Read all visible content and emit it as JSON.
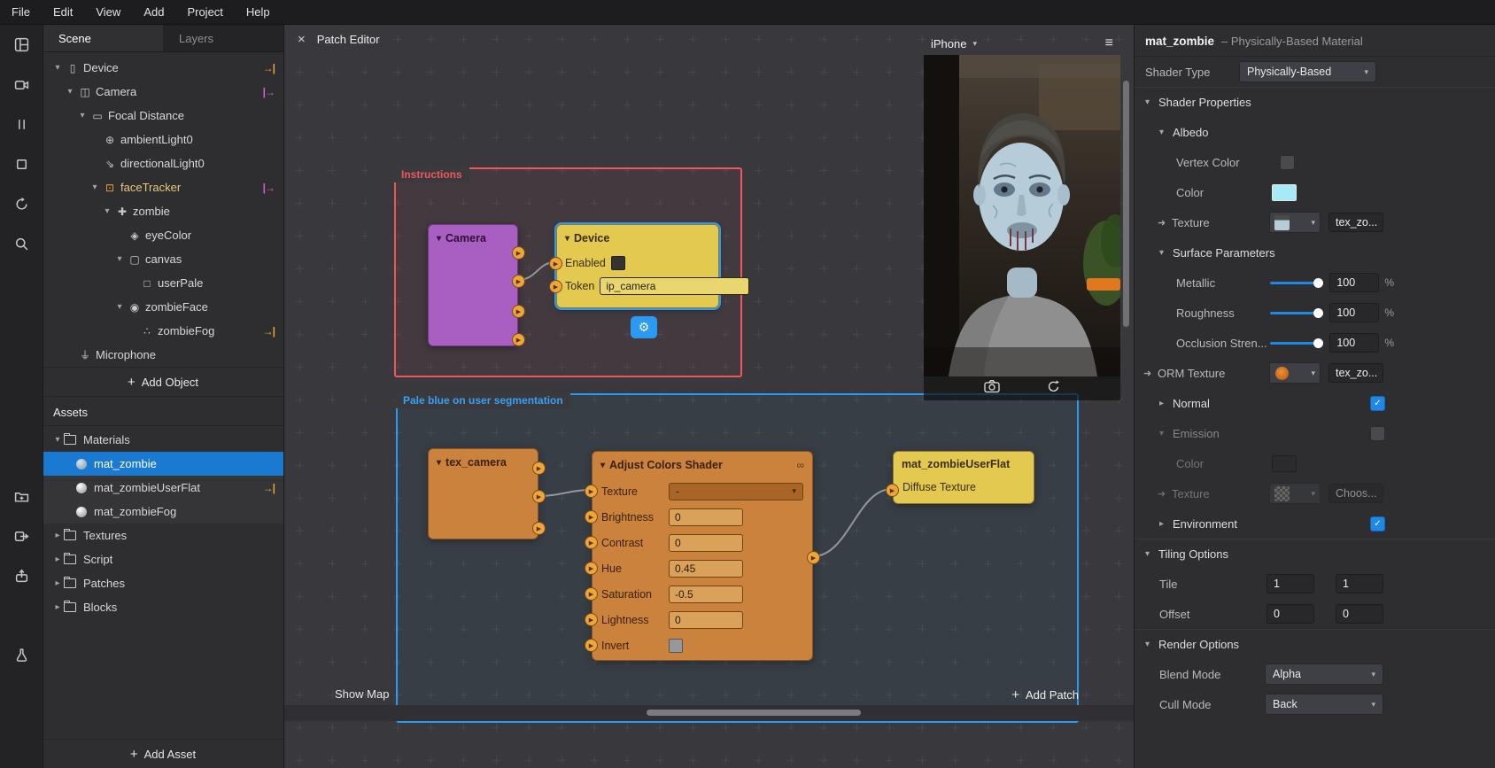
{
  "menu": {
    "items": [
      {
        "label": "File"
      },
      {
        "label": "Edit"
      },
      {
        "label": "View"
      },
      {
        "label": "Add"
      },
      {
        "label": "Project"
      },
      {
        "label": "Help"
      }
    ]
  },
  "icons": {
    "caret_down": "▾",
    "caret_right": "▸",
    "close": "×",
    "hamburger": "≡",
    "chevron_down": "▾",
    "plus": "+",
    "check": "✓",
    "gear": "⚙",
    "link": "∞",
    "port_arrow": "▶",
    "texture_arrow": "➜",
    "device": "▯",
    "camera": "◫",
    "focal_distance": "▭",
    "ambient_light": "⊕",
    "directional_light": "⇘",
    "face_tracker": "⊡",
    "object_3d": "✚",
    "mesh": "◈",
    "canvas": "▢",
    "rectangle": "□",
    "face_mesh": "◉",
    "particles": "∴",
    "microphone": "⏚"
  },
  "toolbar": {
    "icons": [
      "panels",
      "video",
      "pause",
      "stop",
      "restart",
      "search",
      "add-folder",
      "export",
      "publish",
      "test"
    ]
  },
  "scene": {
    "tabs": [
      {
        "label": "Scene"
      },
      {
        "label": "Layers"
      }
    ],
    "items": [
      {
        "label": "Device",
        "badge": "→|"
      },
      {
        "label": "Camera",
        "badge": "|→"
      },
      {
        "label": "Focal Distance"
      },
      {
        "label": "ambientLight0"
      },
      {
        "label": "directionalLight0"
      },
      {
        "label": "faceTracker",
        "badge": "|→"
      },
      {
        "label": "zombie"
      },
      {
        "label": "eyeColor"
      },
      {
        "label": "canvas"
      },
      {
        "label": "userPale"
      },
      {
        "label": "zombieFace"
      },
      {
        "label": "zombieFog",
        "badge": "→|"
      },
      {
        "label": "Microphone"
      }
    ],
    "add_object": "Add Object"
  },
  "assets": {
    "title": "Assets",
    "items": [
      {
        "label": "Materials"
      },
      {
        "label": "mat_zombie"
      },
      {
        "label": "mat_zombieUserFlat",
        "badge": "→|"
      },
      {
        "label": "mat_zombieFog"
      },
      {
        "label": "Textures"
      },
      {
        "label": "Script"
      },
      {
        "label": "Patches"
      },
      {
        "label": "Blocks"
      }
    ],
    "add_asset": "Add Asset"
  },
  "patch_editor": {
    "title": "Patch Editor",
    "show_map": "Show Map",
    "add_patch": "Add Patch",
    "groups": [
      {
        "label": "Instructions",
        "color": "#f2555c"
      },
      {
        "label": "Pale blue on user segmentation",
        "color": "#2b9af3"
      }
    ],
    "camera": {
      "title": "Camera"
    },
    "device": {
      "title": "Device",
      "rows": [
        {
          "label": "Enabled"
        },
        {
          "label": "Token",
          "value": "ip_camera"
        }
      ]
    },
    "tex_camera": {
      "title": "tex_camera"
    },
    "adjust": {
      "title": "Adjust Colors Shader",
      "rows": [
        {
          "label": "Texture",
          "value": "-"
        },
        {
          "label": "Brightness",
          "value": "0"
        },
        {
          "label": "Contrast",
          "value": "0"
        },
        {
          "label": "Hue",
          "value": "0.45"
        },
        {
          "label": "Saturation",
          "value": "-0.5"
        },
        {
          "label": "Lightness",
          "value": "0"
        },
        {
          "label": "Invert"
        }
      ]
    },
    "mat": {
      "title": "mat_zombieUserFlat",
      "row": "Diffuse Texture"
    }
  },
  "simulator": {
    "device": "iPhone"
  },
  "inspector": {
    "title": "mat_zombie",
    "subtitle": "– Physically-Based Material",
    "shader_type_label": "Shader Type",
    "shader_type_value": "Physically-Based",
    "shader_properties": "Shader Properties",
    "albedo": "Albedo",
    "vertex_color": "Vertex Color",
    "color": "Color",
    "texture": "Texture",
    "texture_value": "tex_zo...",
    "surface_parameters": "Surface Parameters",
    "metallic": "Metallic",
    "metallic_value": "100",
    "roughness": "Roughness",
    "roughness_value": "100",
    "occlusion": "Occlusion Stren...",
    "occlusion_value": "100",
    "percent": "%",
    "orm_texture": "ORM Texture",
    "orm_value": "tex_zo...",
    "normal": "Normal",
    "emission": "Emission",
    "emission_color": "Color",
    "emission_texture": "Texture",
    "emission_texture_value": "Choos...",
    "environment": "Environment",
    "tiling_options": "Tiling Options",
    "tile": "Tile",
    "tile_x": "1",
    "tile_y": "1",
    "offset": "Offset",
    "offset_x": "0",
    "offset_y": "0",
    "render_options": "Render Options",
    "blend_mode": "Blend Mode",
    "blend_value": "Alpha",
    "cull_mode": "Cull Mode",
    "cull_value": "Back",
    "colors": {
      "accent": "#2b9af3",
      "albedo_color": "#a6e9f7",
      "orm_thumb": "#e87a1e"
    }
  }
}
